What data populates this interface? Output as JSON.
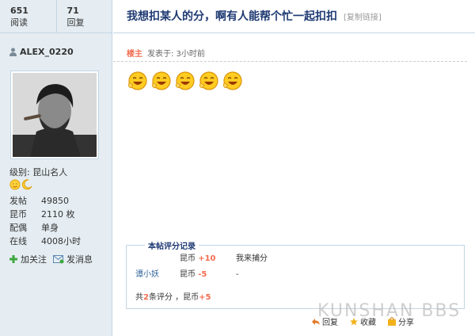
{
  "stats": {
    "views": "651",
    "views_label": "阅读",
    "replies": "71",
    "replies_label": "回复"
  },
  "author": {
    "name": "ALEX_0220"
  },
  "profile": {
    "level_label": "级别:",
    "level_value": "昆山名人",
    "rows": [
      {
        "key": "发帖",
        "value": "49850"
      },
      {
        "key": "昆币",
        "value": "2110 枚"
      },
      {
        "key": "配偶",
        "value": "单身"
      },
      {
        "key": "在线",
        "value": "4008小时"
      }
    ],
    "follow_label": "加关注",
    "message_label": "发消息"
  },
  "thread": {
    "title": "我想扣某人的分，啊有人能帮个忙一起扣扣",
    "copy_link": "[复制链接]"
  },
  "post": {
    "op_badge": "楼主",
    "time": "发表于: 3小时前",
    "emote_count": 5
  },
  "rating": {
    "title": "本帖评分记录",
    "rows": [
      {
        "user": "",
        "currency": "昆币",
        "amount": "+10",
        "reason": "我来捕分"
      },
      {
        "user": "谭小妖",
        "currency": "昆币",
        "amount": "-5",
        "reason": "-"
      }
    ],
    "summary_prefix": "共",
    "summary_count": "2",
    "summary_mid": "条评分 ，昆币",
    "summary_total": "+5"
  },
  "bottom": {
    "reply": "回复",
    "favorite": "收藏",
    "share": "分享"
  },
  "watermark": "KUNSHAN BBS",
  "colors": {
    "left_bg": "#e5edf2",
    "border": "#c2d5e3",
    "title": "#1f3a73",
    "accent": "#f26c4f"
  }
}
